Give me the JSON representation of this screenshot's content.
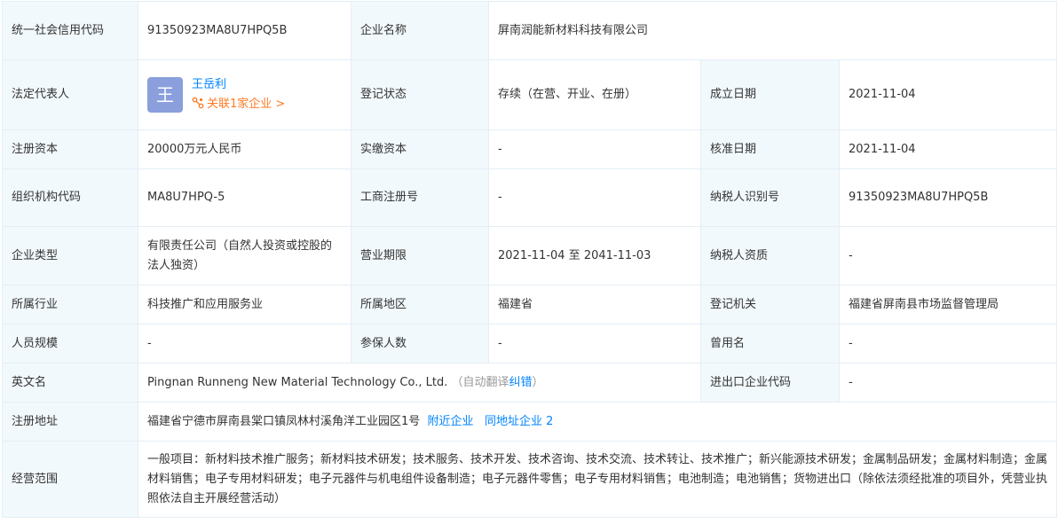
{
  "rows": {
    "r1": {
      "l1": "统一社会信用代码",
      "v1": "91350923MA8U7HPQ5B",
      "l2": "企业名称",
      "v2": "屏南润能新材料科技有限公司"
    },
    "r2": {
      "l1": "法定代表人",
      "avatar_char": "王",
      "rep_name": "王岳利",
      "rep_link": "关联1家企业 >",
      "l2": "登记状态",
      "v2": "存续（在营、开业、在册）",
      "l3": "成立日期",
      "v3": "2021-11-04"
    },
    "r3": {
      "l1": "注册资本",
      "v1": "20000万元人民币",
      "l2": "实缴资本",
      "v2": "-",
      "l3": "核准日期",
      "v3": "2021-11-04"
    },
    "r4": {
      "l1": "组织机构代码",
      "v1": "MA8U7HPQ-5",
      "l2": "工商注册号",
      "v2": "-",
      "l3": "纳税人识别号",
      "v3": "91350923MA8U7HPQ5B"
    },
    "r5": {
      "l1": "企业类型",
      "v1": "有限责任公司（自然人投资或控股的法人独资）",
      "l2": "营业期限",
      "v2": "2021-11-04 至 2041-11-03",
      "l3": "纳税人资质",
      "v3": "-"
    },
    "r6": {
      "l1": "所属行业",
      "v1": "科技推广和应用服务业",
      "l2": "所属地区",
      "v2": "福建省",
      "l3": "登记机关",
      "v3": "福建省屏南县市场监督管理局"
    },
    "r7": {
      "l1": "人员规模",
      "v1": "-",
      "l2": "参保人数",
      "v2": "-",
      "l3": "曾用名",
      "v3": "-"
    },
    "r8": {
      "l1": "英文名",
      "v1": "Pingnan Runneng New Material Technology Co., Ltd.",
      "auto_prefix": "（自动翻译",
      "correct_link": "纠错",
      "auto_suffix": "）",
      "l3": "进出口企业代码",
      "v3": "-"
    },
    "r9": {
      "l1": "注册地址",
      "v1": "福建省宁德市屏南县棠口镇凤林村溪角洋工业园区1号",
      "nearby_link": "附近企业",
      "same_addr_link": "同地址企业 2"
    },
    "r10": {
      "l1": "经营范围",
      "v1": "一般项目：新材料技术推广服务；新材料技术研发；技术服务、技术开发、技术咨询、技术交流、技术转让、技术推广；新兴能源技术研发；金属制品研发；金属材料制造；金属材料销售；电子专用材料研发；电子元器件与机电组件设备制造；电子元器件零售；电子专用材料销售；电池制造；电池销售；货物进出口（除依法须经批准的项目外，凭营业执照依法自主开展经营活动）"
    }
  },
  "colors": {
    "label_bg": "#f2f9fc",
    "border": "#e4eef6",
    "link": "#0084ff",
    "orange": "#ff7a24",
    "avatar_bg": "#8a9fdc"
  },
  "icons": {
    "related": "relation-icon"
  }
}
